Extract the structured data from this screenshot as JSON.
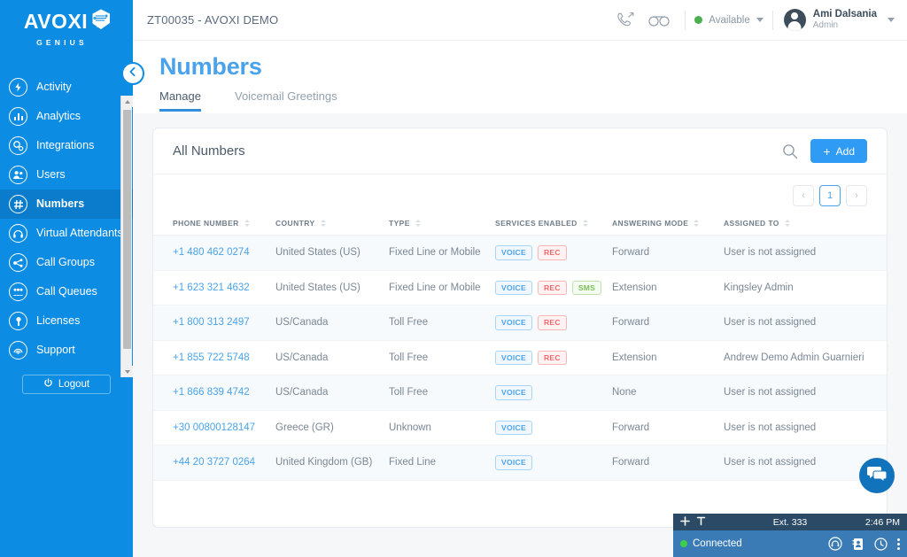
{
  "sidebar": {
    "logo": {
      "word": "AVOXI",
      "sub": "GENIUS",
      "badge_icon": "brain-badge-icon"
    },
    "items": [
      {
        "label": "Activity",
        "icon": "activity-icon",
        "active": false
      },
      {
        "label": "Analytics",
        "icon": "analytics-icon",
        "active": false
      },
      {
        "label": "Integrations",
        "icon": "integrations-icon",
        "active": false
      },
      {
        "label": "Users",
        "icon": "users-icon",
        "active": false
      },
      {
        "label": "Numbers",
        "icon": "numbers-hash-icon",
        "active": true
      },
      {
        "label": "Virtual Attendants",
        "icon": "virtual-attendant-icon",
        "active": false
      },
      {
        "label": "Call Groups",
        "icon": "call-groups-icon",
        "active": false
      },
      {
        "label": "Call Queues",
        "icon": "call-queues-icon",
        "active": false
      },
      {
        "label": "Licenses",
        "icon": "licenses-key-icon",
        "active": false
      },
      {
        "label": "Support",
        "icon": "support-icon",
        "active": false
      }
    ],
    "logout_label": "Logout",
    "logout_icon": "power-icon",
    "collapse_icon": "chevron-left-circle-icon"
  },
  "topbar": {
    "account": "ZT00035 - AVOXI DEMO",
    "call_icon": "outgoing-call-icon",
    "voicemail_icon": "voicemail-icon",
    "availability": {
      "status": "Available",
      "color": "#4caf50"
    },
    "user": {
      "name": "Ami Dalsania",
      "role": "Admin"
    }
  },
  "page": {
    "title": "Numbers",
    "tabs": [
      {
        "label": "Manage",
        "active": true
      },
      {
        "label": "Voicemail Greetings",
        "active": false
      }
    ]
  },
  "card": {
    "title": "All Numbers",
    "search_icon": "search-icon",
    "add_label": "Add",
    "add_plus": "+",
    "pagination": {
      "prev": "‹",
      "current": "1",
      "next": "›"
    },
    "columns": [
      "PHONE NUMBER",
      "COUNTRY",
      "TYPE",
      "SERVICES ENABLED",
      "ANSWERING MODE",
      "ASSIGNED TO"
    ],
    "rows": [
      {
        "phone": "+1 480 462 0274",
        "country": "United States (US)",
        "type": "Fixed Line or Mobile",
        "services": [
          "VOICE",
          "REC"
        ],
        "answering_mode": "Forward",
        "assigned_to": "User is not assigned"
      },
      {
        "phone": "+1 623 321 4632",
        "country": "United States (US)",
        "type": "Fixed Line or Mobile",
        "services": [
          "VOICE",
          "REC",
          "SMS"
        ],
        "answering_mode": "Extension",
        "assigned_to": "Kingsley Admin"
      },
      {
        "phone": "+1 800 313 2497",
        "country": "US/Canada",
        "type": "Toll Free",
        "services": [
          "VOICE",
          "REC"
        ],
        "answering_mode": "Forward",
        "assigned_to": "User is not assigned"
      },
      {
        "phone": "+1 855 722 5748",
        "country": "US/Canada",
        "type": "Toll Free",
        "services": [
          "VOICE",
          "REC"
        ],
        "answering_mode": "Extension",
        "assigned_to": "Andrew Demo Admin Guarnieri"
      },
      {
        "phone": "+1 866 839 4742",
        "country": "US/Canada",
        "type": "Toll Free",
        "services": [
          "VOICE"
        ],
        "answering_mode": "None",
        "assigned_to": "User is not assigned"
      },
      {
        "phone": "+30 00800128147",
        "country": "Greece (GR)",
        "type": "Unknown",
        "services": [
          "VOICE"
        ],
        "answering_mode": "Forward",
        "assigned_to": "User is not assigned"
      },
      {
        "phone": "+44 20 3727 0264",
        "country": "United Kingdom (GB)",
        "type": "Fixed Line",
        "services": [
          "VOICE"
        ],
        "answering_mode": "Forward",
        "assigned_to": "User is not assigned"
      }
    ]
  },
  "chat_fab": {
    "icon": "chat-bubbles-icon"
  },
  "softphone": {
    "extension": "Ext. 333",
    "time": "2:46 PM",
    "status": "Connected",
    "status_color": "#3ecf4a",
    "title_icons": [
      "plus-icon",
      "collapse-bar-icon"
    ],
    "body_icons": [
      "headset-add-icon",
      "contacts-icon",
      "history-clock-icon",
      "more-vertical-icon"
    ]
  },
  "colors": {
    "sidebar_blue": "#0c8ce3",
    "accent_blue": "#2f9bf5",
    "title_blue": "#4aa3ea",
    "badge_voice": "#4aa3ea",
    "badge_rec": "#f06a6a",
    "badge_sms": "#7bbf5a",
    "softphone_title": "#2a4a66",
    "softphone_body": "#3a7bb5"
  }
}
